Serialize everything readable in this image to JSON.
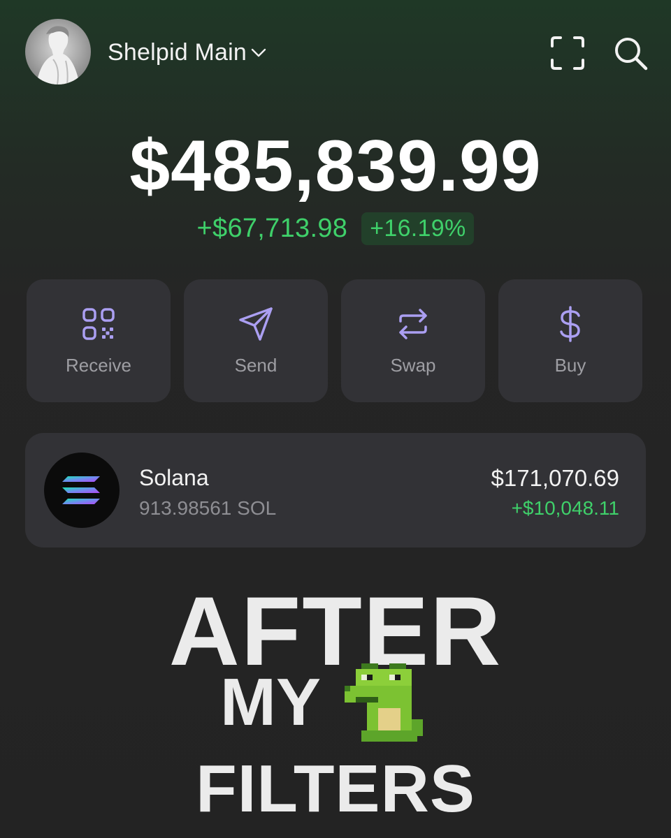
{
  "header": {
    "account_name": "Shelpid Main",
    "icons": [
      "avatar",
      "chevron-down-icon",
      "scan-icon",
      "search-icon"
    ]
  },
  "balance": {
    "total": "$485,839.99",
    "change_amount": "+$67,713.98",
    "change_percent": "+16.19%"
  },
  "actions": [
    {
      "label": "Receive",
      "icon": "qr-code-icon"
    },
    {
      "label": "Send",
      "icon": "send-icon"
    },
    {
      "label": "Swap",
      "icon": "swap-icon"
    },
    {
      "label": "Buy",
      "icon": "dollar-icon"
    }
  ],
  "tokens": [
    {
      "name": "Solana",
      "amount": "913.98561 SOL",
      "value": "$171,070.69",
      "change": "+$10,048.11",
      "icon": "solana-logo-icon"
    }
  ],
  "caption": {
    "line1": "AFTER",
    "line2": "MY",
    "line3": "FILTERS",
    "emoji": "pixel-frog-icon"
  },
  "colors": {
    "positive": "#3fd06a",
    "accent_icon": "#ab9ff2",
    "card_background": "#323236"
  }
}
